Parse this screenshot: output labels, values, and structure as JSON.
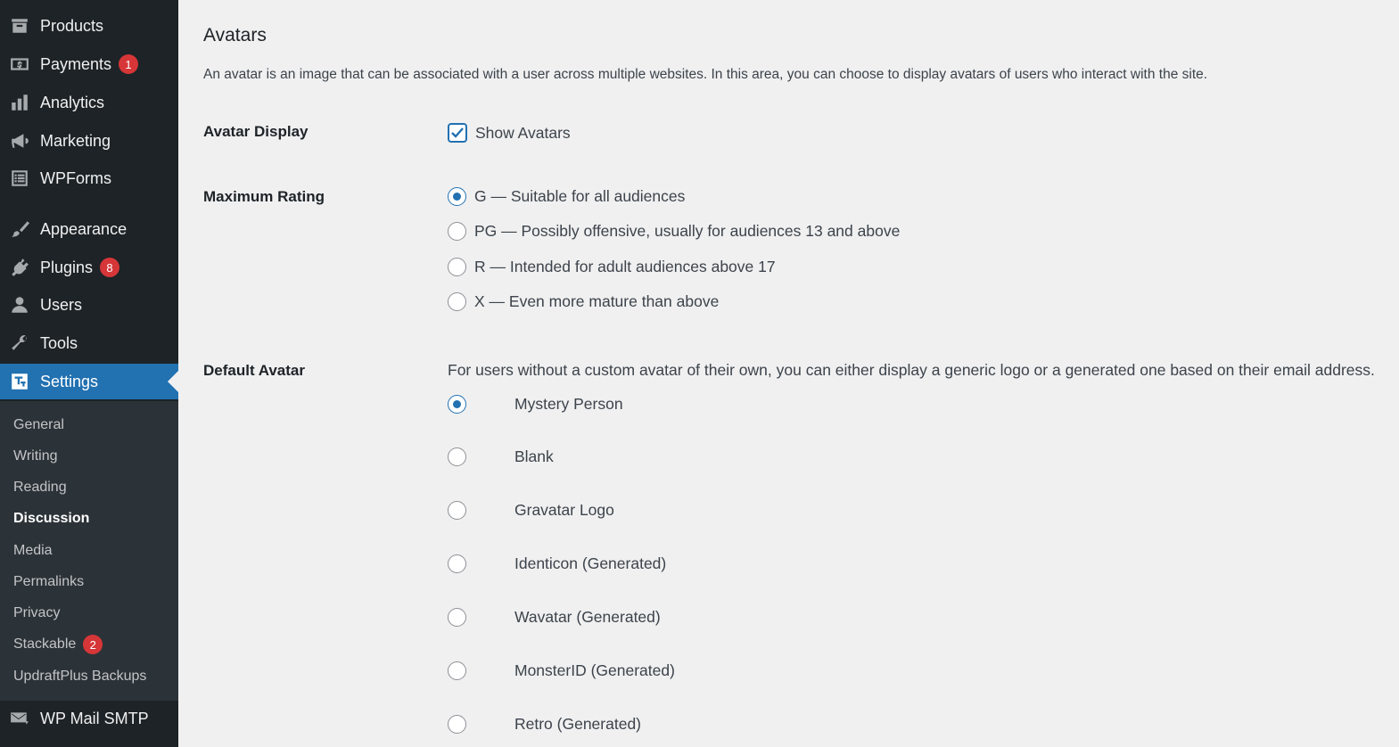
{
  "sidebar": {
    "items": [
      {
        "label": "Products",
        "icon": "archive-icon"
      },
      {
        "label": "Payments",
        "icon": "dollar-icon",
        "badge": "1"
      },
      {
        "label": "Analytics",
        "icon": "bar-chart-icon"
      },
      {
        "label": "Marketing",
        "icon": "megaphone-icon"
      },
      {
        "label": "WPForms",
        "icon": "form-icon"
      },
      {
        "label": "Appearance",
        "icon": "paintbrush-icon"
      },
      {
        "label": "Plugins",
        "icon": "plugin-icon",
        "badge": "8"
      },
      {
        "label": "Users",
        "icon": "user-icon"
      },
      {
        "label": "Tools",
        "icon": "wrench-icon"
      },
      {
        "label": "Settings",
        "icon": "settings-icon",
        "active": true
      },
      {
        "label": "WP Mail SMTP",
        "icon": "mail-icon"
      }
    ],
    "submenu": [
      {
        "label": "General"
      },
      {
        "label": "Writing"
      },
      {
        "label": "Reading"
      },
      {
        "label": "Discussion",
        "current": true
      },
      {
        "label": "Media"
      },
      {
        "label": "Permalinks"
      },
      {
        "label": "Privacy"
      },
      {
        "label": "Stackable",
        "badge": "2"
      },
      {
        "label": "UpdraftPlus Backups"
      }
    ]
  },
  "main": {
    "title": "Avatars",
    "description": "An avatar is an image that can be associated with a user across multiple websites. In this area, you can choose to display avatars of users who interact with the site.",
    "avatar_display": {
      "label": "Avatar Display",
      "checkbox_label": "Show Avatars",
      "checked": true
    },
    "maximum_rating": {
      "label": "Maximum Rating",
      "options": [
        {
          "label": "G — Suitable for all audiences",
          "checked": true
        },
        {
          "label": "PG — Possibly offensive, usually for audiences 13 and above",
          "checked": false
        },
        {
          "label": "R — Intended for adult audiences above 17",
          "checked": false
        },
        {
          "label": "X — Even more mature than above",
          "checked": false
        }
      ]
    },
    "default_avatar": {
      "label": "Default Avatar",
      "description": "For users without a custom avatar of their own, you can either display a generic logo or a generated one based on their email address.",
      "options": [
        {
          "label": "Mystery Person",
          "checked": true
        },
        {
          "label": "Blank",
          "checked": false
        },
        {
          "label": "Gravatar Logo",
          "checked": false
        },
        {
          "label": "Identicon (Generated)",
          "checked": false
        },
        {
          "label": "Wavatar (Generated)",
          "checked": false
        },
        {
          "label": "MonsterID (Generated)",
          "checked": false
        },
        {
          "label": "Retro (Generated)",
          "checked": false
        }
      ]
    }
  },
  "colors": {
    "sidebar_bg": "#1d2327",
    "submenu_bg": "#2c3338",
    "accent": "#2271b1",
    "badge": "#d63638",
    "page_bg": "#f0f0f1"
  }
}
